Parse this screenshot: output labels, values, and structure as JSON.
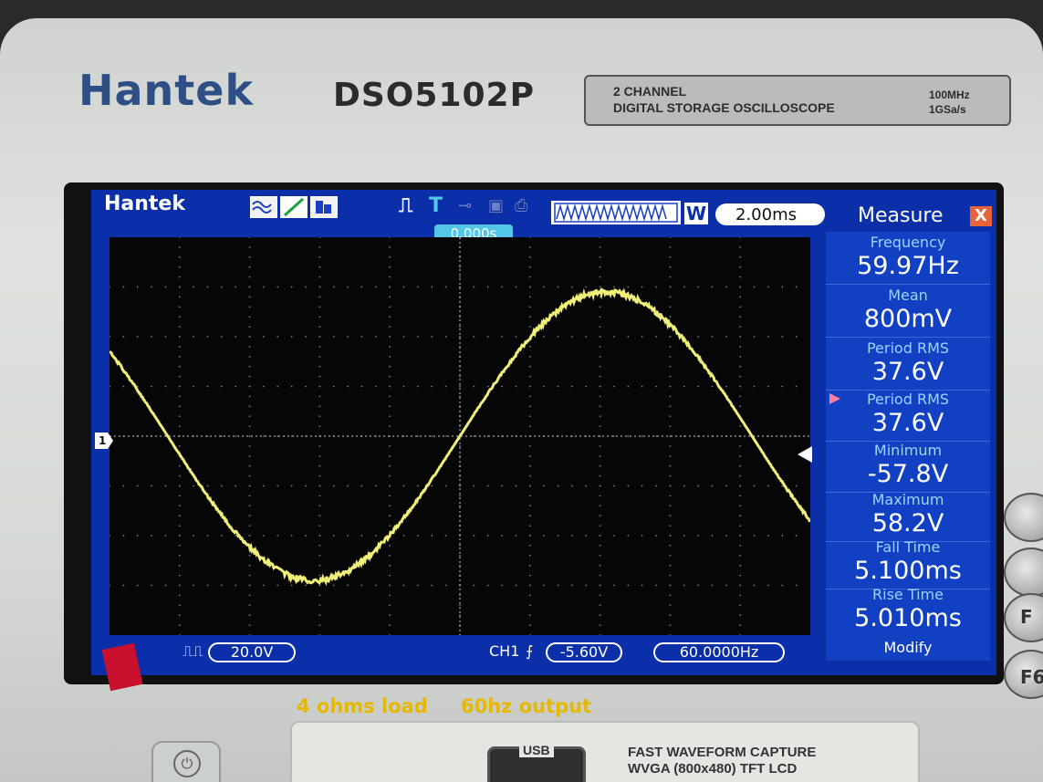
{
  "device": {
    "brand": "Hantek",
    "model": "DSO5102P",
    "spec_line1": "2 CHANNEL",
    "spec_line2": "DIGITAL STORAGE OSCILLOSCOPE",
    "spec_bandwidth": "100MHz",
    "spec_sample": "1GSa/s"
  },
  "screen": {
    "logo": "Hantek",
    "timebase": "2.00ms",
    "w_label": "W",
    "trigger_position": "0.000s",
    "channel_marker": "1"
  },
  "measure": {
    "title": "Measure",
    "close": "X",
    "items": [
      {
        "label": "Frequency",
        "value": "59.97Hz"
      },
      {
        "label": "Mean",
        "value": "800mV"
      },
      {
        "label": "Period RMS",
        "value": "37.6V"
      },
      {
        "label": "Period RMS",
        "value": "37.6V"
      },
      {
        "label": "Minimum",
        "value": "-57.8V"
      },
      {
        "label": "Maximum",
        "value": "58.2V"
      },
      {
        "label": "Fall Time",
        "value": "5.100ms"
      },
      {
        "label": "Rise Time",
        "value": "5.010ms"
      }
    ],
    "modify": "Modify"
  },
  "status_bar": {
    "coupling": "20.0V",
    "trigger_channel": "CH1",
    "trigger_level": "-5.60V",
    "counter": "60.0000Hz"
  },
  "caption": {
    "load": "4 ohms load",
    "output": "60hz output"
  },
  "lower_panel": {
    "usb": "USB",
    "feature1": "FAST WAVEFORM CAPTURE",
    "feature2": "WVGA (800x480) TFT LCD",
    "side_f": "F",
    "side_f6": "F6"
  },
  "colors": {
    "trace": "#f2ee7a",
    "lcd": "#0a2fa8",
    "brand": "#2d4f86",
    "caption": "#e6b800"
  },
  "waveform": {
    "frequency_hz": 59.97,
    "amplitude_v": 58,
    "volts_per_div": 20.0,
    "time_per_div_ms": 2.0
  }
}
